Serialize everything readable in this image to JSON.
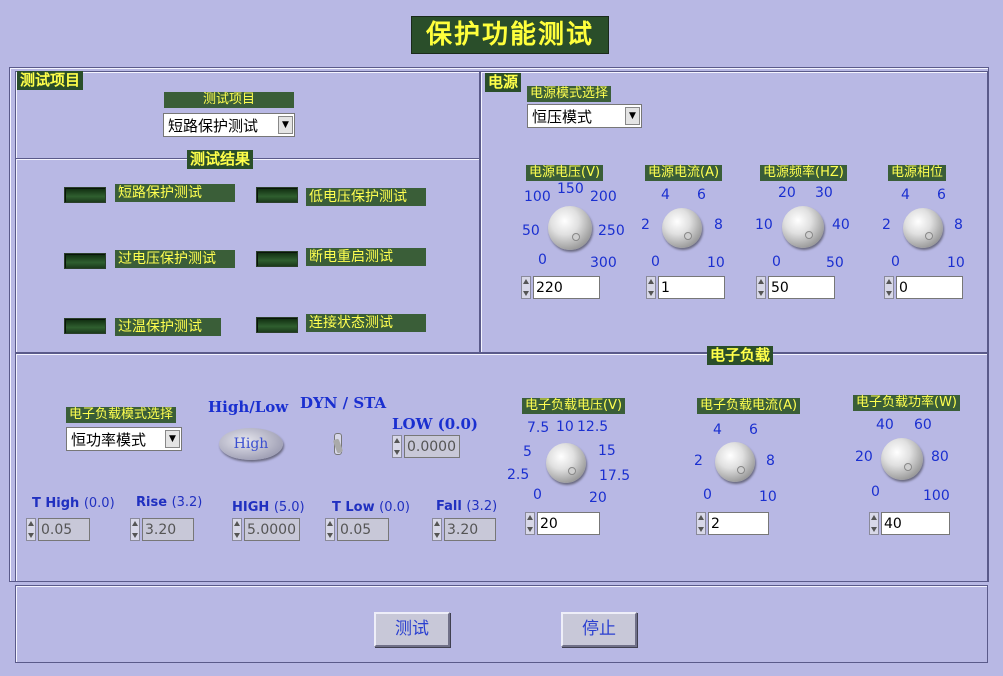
{
  "title": "保护功能测试",
  "test_items_section": {
    "title": "测试项目",
    "selector_label": "测试项目",
    "selector_value": "短路保护测试"
  },
  "results_section": {
    "title": "测试结果",
    "items": [
      "短路保护测试",
      "低电压保护测试",
      "过电压保护测试",
      "断电重启测试",
      "过温保护测试",
      "连接状态测试"
    ]
  },
  "power_section": {
    "title": "电源",
    "mode_label": "电源模式选择",
    "mode_value": "恒压模式",
    "knobs": [
      {
        "label": "电源电压(V)",
        "value": "220",
        "ticks": [
          "100",
          "150",
          "200",
          "50",
          "250",
          "0",
          "300"
        ]
      },
      {
        "label": "电源电流(A)",
        "value": "1",
        "ticks": [
          "4",
          "6",
          "2",
          "8",
          "0",
          "10"
        ]
      },
      {
        "label": "电源频率(HZ)",
        "value": "50",
        "ticks": [
          "20",
          "30",
          "10",
          "40",
          "0",
          "50"
        ]
      },
      {
        "label": "电源相位",
        "value": "0",
        "ticks": [
          "4",
          "6",
          "2",
          "8",
          "0",
          "10"
        ]
      }
    ]
  },
  "load_section": {
    "title": "电子负载",
    "mode_label": "电子负载模式选择",
    "mode_value": "恒功率模式",
    "highlow_label": "High/Low",
    "highlow_value": "High",
    "dynsta_label": "DYN / STA",
    "low_label": "LOW (0.0)",
    "low_value": "0.0000",
    "params": [
      {
        "name": "T High",
        "default": "(0.0)",
        "value": "0.05"
      },
      {
        "name": "Rise",
        "default": "(3.2)",
        "value": "3.20"
      },
      {
        "name": "HIGH",
        "default": "(5.0)",
        "value": "5.0000"
      },
      {
        "name": "T Low",
        "default": "(0.0)",
        "value": "0.05"
      },
      {
        "name": "Fall",
        "default": "(3.2)",
        "value": "3.20"
      }
    ],
    "knobs": [
      {
        "label": "电子负载电压(V)",
        "value": "20",
        "ticks": [
          "7.5",
          "10",
          "12.5",
          "5",
          "15",
          "2.5",
          "17.5",
          "0",
          "20"
        ]
      },
      {
        "label": "电子负载电流(A)",
        "value": "2",
        "ticks": [
          "4",
          "6",
          "2",
          "8",
          "0",
          "10"
        ]
      },
      {
        "label": "电子负载功率(W)",
        "value": "40",
        "ticks": [
          "40",
          "60",
          "20",
          "80",
          "0",
          "100"
        ]
      }
    ]
  },
  "buttons": {
    "test": "测试",
    "stop": "停止"
  },
  "colors": {
    "background": "#b8b8e4",
    "label_bg": "#3a5e38",
    "label_text": "#ffff50",
    "tick_text": "#1a2fd0"
  }
}
